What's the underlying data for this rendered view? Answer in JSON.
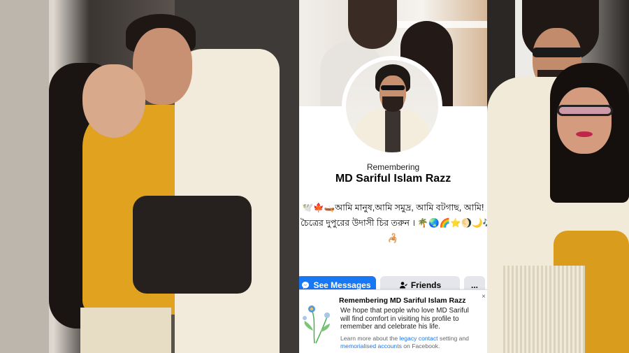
{
  "profile": {
    "memorial_label": "Remembering",
    "name": "MD Sariful Islam Razz",
    "bio_line1": "🕊️🍁🛶আমি মানুষ,আমি সমুদ্র, আমি বটগাছ, আমি!",
    "bio_line2": "চৈত্রের দুপুরের উদাসী চির তরুন । 🌴🌏🌈⭐🌖🌙🎶",
    "bio_line3": "🦂"
  },
  "actions": {
    "messages_label": "See Messages",
    "friends_label": "Friends",
    "more_label": "..."
  },
  "memorial_card": {
    "title": "Remembering MD Sariful Islam Razz",
    "body": "We hope that people who love MD Sariful will find comfort in visiting his profile to remember and celebrate his life.",
    "footer_prefix": "Learn more about the",
    "legacy_link": "legacy contact",
    "footer_middle": "setting and",
    "memorialised_link": "memorialised accounts",
    "footer_suffix": "on Facebook.",
    "close_glyph": "×"
  },
  "icons": {
    "messenger": "messenger-icon",
    "friends": "friends-icon",
    "more": "more-icon",
    "close": "close-icon",
    "flower": "flower-illustration"
  },
  "colors": {
    "facebook_blue": "#1877f2",
    "button_gray": "#e4e6eb",
    "secondary_text": "#65676b"
  }
}
